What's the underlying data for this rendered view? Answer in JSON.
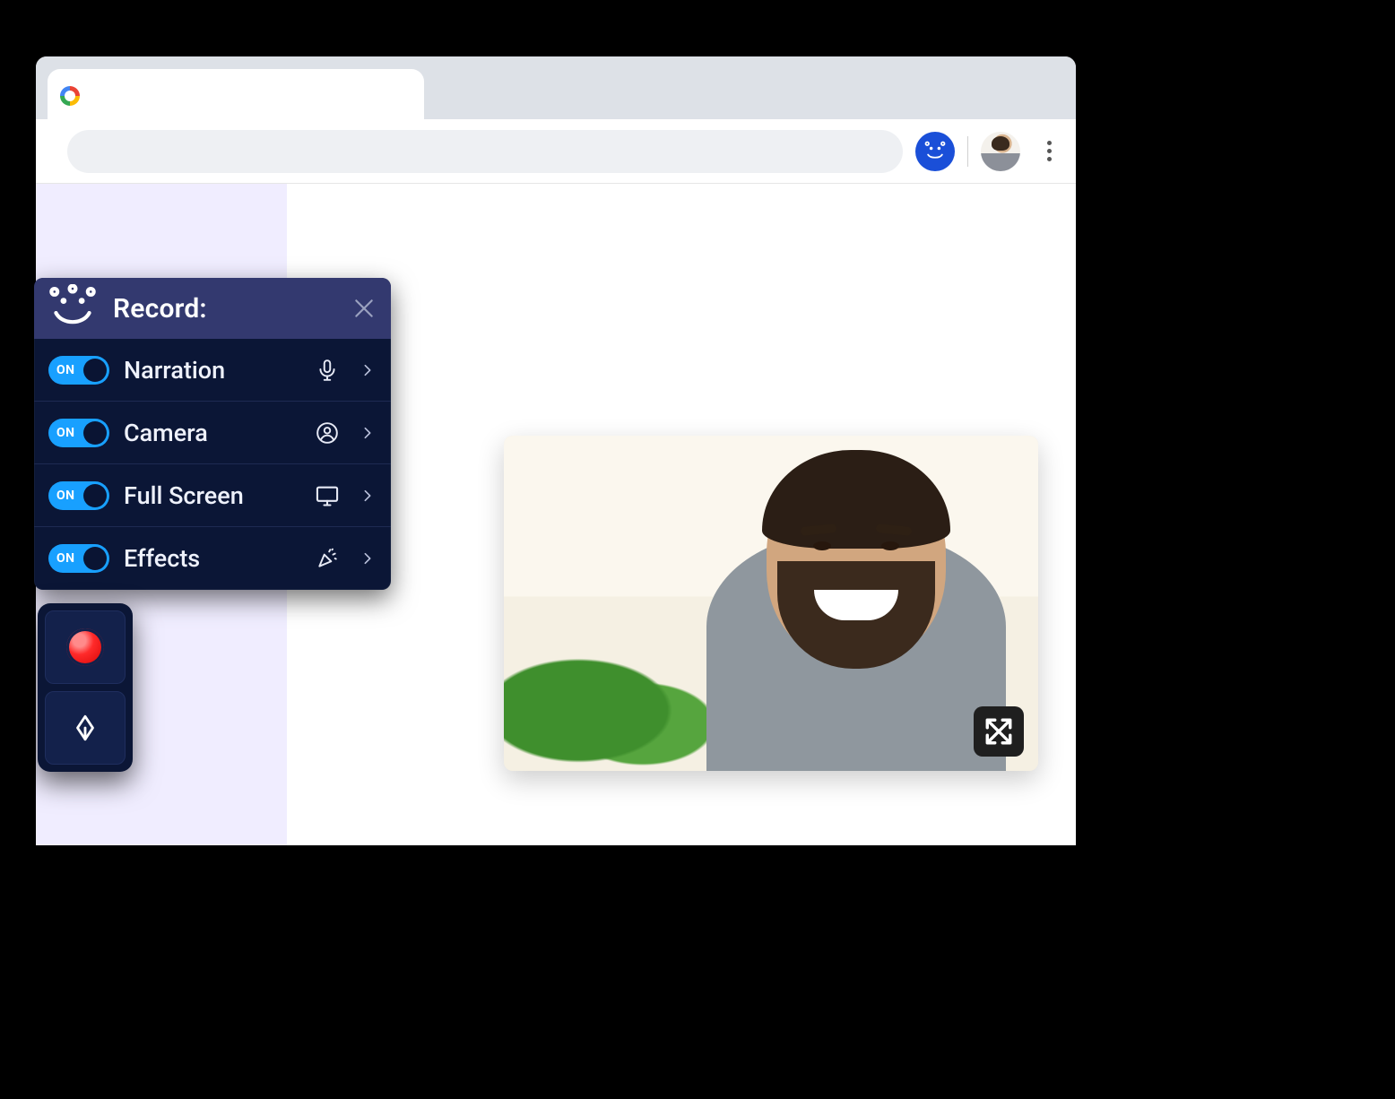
{
  "colors": {
    "panel_bg": "#0b1636",
    "panel_header": "#33396f",
    "accent": "#18a0ff",
    "ext_icon_bg": "#1a4fd8"
  },
  "browser": {
    "omnibox_value": "",
    "omnibox_placeholder": ""
  },
  "panel": {
    "title": "Record:",
    "rows": [
      {
        "id": "narration",
        "label": "Narration",
        "toggle_text": "ON",
        "on": true,
        "icon": "microphone-icon"
      },
      {
        "id": "camera",
        "label": "Camera",
        "toggle_text": "ON",
        "on": true,
        "icon": "user-circle-icon"
      },
      {
        "id": "fullscreen",
        "label": "Full Screen",
        "toggle_text": "ON",
        "on": true,
        "icon": "monitor-icon"
      },
      {
        "id": "effects",
        "label": "Effects",
        "toggle_text": "ON",
        "on": true,
        "icon": "confetti-icon"
      }
    ]
  },
  "quick_controls": {
    "record_label": "Record",
    "draw_label": "Draw"
  },
  "camera_preview": {
    "expand_label": "Expand"
  }
}
